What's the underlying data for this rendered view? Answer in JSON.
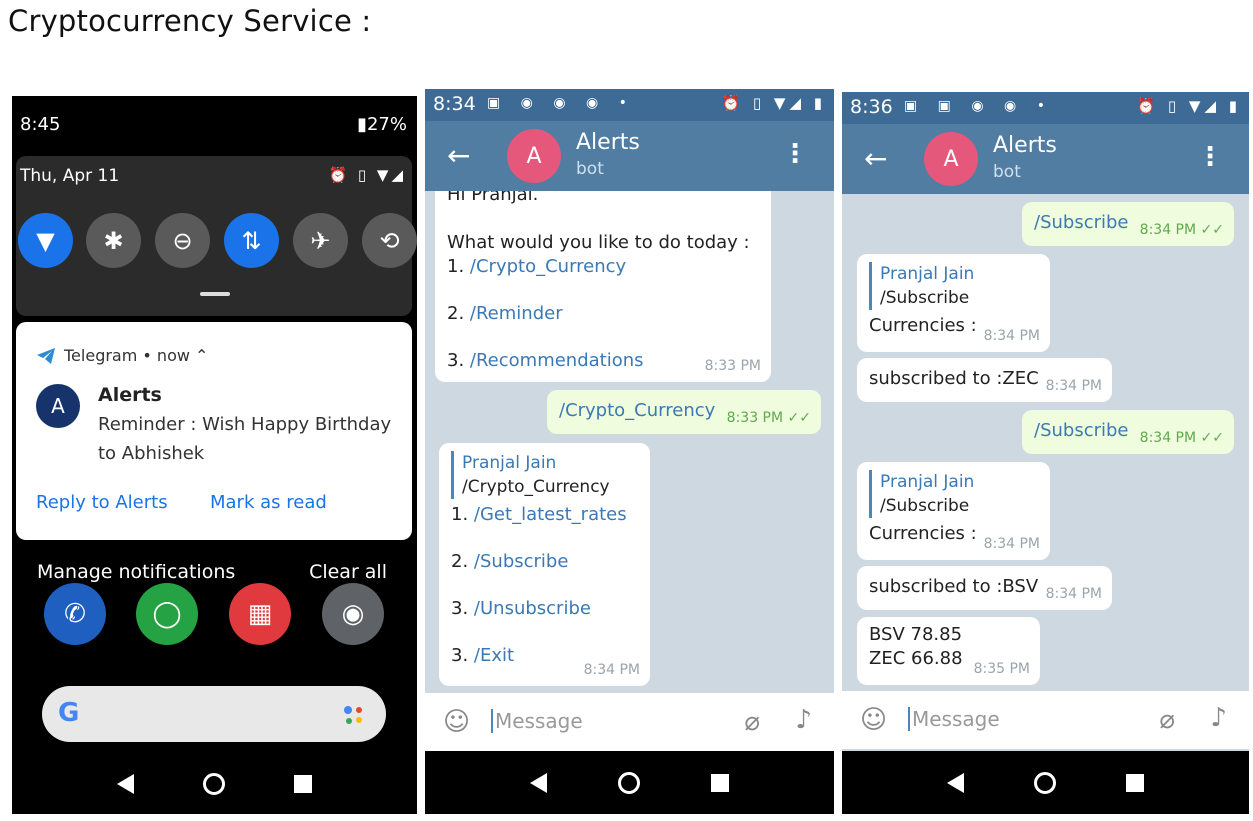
{
  "page_title": "Cryptocurrency Service :",
  "phone1": {
    "status_time": "8:45",
    "battery": "▮27%",
    "qs_date": "Thu, Apr 11",
    "qs_status_icons": "⏰ ▯ ▼◢",
    "tiles": [
      {
        "icon": "wifi-icon",
        "glyph": "▼",
        "on": true
      },
      {
        "icon": "bluetooth-icon",
        "glyph": "✱",
        "on": false
      },
      {
        "icon": "dnd-icon",
        "glyph": "⊖",
        "on": false
      },
      {
        "icon": "data-icon",
        "glyph": "⇅",
        "on": true
      },
      {
        "icon": "airplane-icon",
        "glyph": "✈",
        "on": false
      },
      {
        "icon": "rotate-icon",
        "glyph": "⟲",
        "on": false
      }
    ],
    "notification": {
      "app": "Telegram • now ⌃",
      "avatar_letter": "A",
      "title": "Alerts",
      "body": "Reminder : Wish Happy Birthday to Abhishek",
      "reply_label": "Reply to Alerts",
      "mark_label": "Mark as read"
    },
    "manage_label": "Manage notifications",
    "clear_label": "Clear all",
    "search_g": "G"
  },
  "phone2": {
    "status_time": "8:34",
    "status_icons": "▣ ◉ ◉ ◉ •",
    "status_right": "⏰ ▯ ▼◢ ▮",
    "chat_name": "Alerts",
    "chat_sub": "bot",
    "avatar_letter": "A",
    "messages": {
      "m1_greet": "Hi Pranjal.",
      "m1_q": "What would you like to do today :",
      "m1_opt1_num": "1.",
      "m1_opt1": "/Crypto_Currency",
      "m1_opt2_num": "2.",
      "m1_opt2": "/Reminder",
      "m1_opt3_num": "3.",
      "m1_opt3": "/Recommendations",
      "m1_time": "8:33 PM",
      "m2_text": "/Crypto_Currency",
      "m2_time": "8:33 PM ✓✓",
      "m3_fwd_name": "Pranjal Jain",
      "m3_fwd_text": "/Crypto_Currency",
      "m3_opt1_num": "1.",
      "m3_opt1": "/Get_latest_rates",
      "m3_opt2_num": "2.",
      "m3_opt2": "/Subscribe",
      "m3_opt3_num": "3.",
      "m3_opt3": "/Unsubscribe",
      "m3_opt4_num": "3.",
      "m3_opt4": "/Exit",
      "m3_time": "8:34 PM"
    },
    "input_placeholder": "Message"
  },
  "phone3": {
    "status_time": "8:36",
    "status_icons": "▣ ▣ ◉ ◉ •",
    "status_right": "⏰ ▯ ▼◢ ▮",
    "chat_name": "Alerts",
    "chat_sub": "bot",
    "avatar_letter": "A",
    "messages": {
      "s1_text": "/Subscribe",
      "s1_time": "8:34 PM ✓✓",
      "f1_name": "Pranjal Jain",
      "f1_text": "/Subscribe",
      "f1_body": "Currencies :",
      "f1_time": "8:34 PM",
      "r1_text": "subscribed to :ZEC",
      "r1_time": "8:34 PM",
      "s2_text": "/Subscribe",
      "s2_time": "8:34 PM ✓✓",
      "f2_name": "Pranjal Jain",
      "f2_text": "/Subscribe",
      "f2_body": "Currencies :",
      "f2_time": "8:34 PM",
      "r2_text": "subscribed to :BSV",
      "r2_time": "8:34 PM",
      "rates_line1": "BSV  78.85",
      "rates_line2": "ZEC  66.88",
      "rates_time": "8:35 PM"
    },
    "input_placeholder": "Message"
  }
}
